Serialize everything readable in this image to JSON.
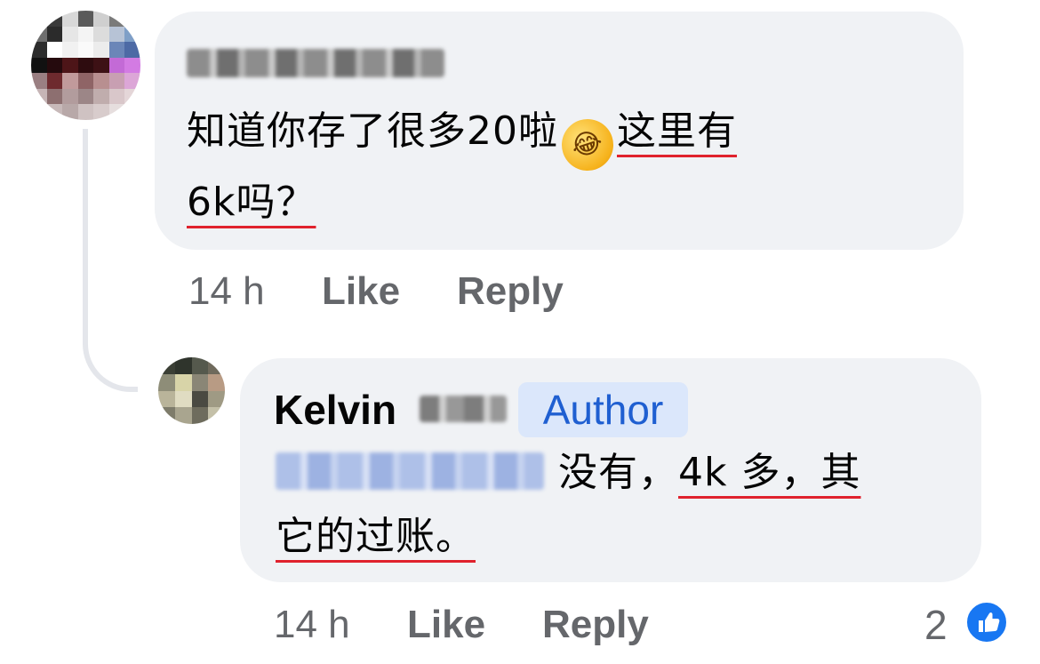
{
  "comment": {
    "author_name_blurred": "",
    "text_line1": "知道你存了很多20啦",
    "emoji_name": "rolling-on-floor-laughing",
    "text_highlight_1": "这里有",
    "text_line2_highlight": "6k吗？",
    "time": "14 h",
    "like_label": "Like",
    "reply_label": "Reply"
  },
  "reply": {
    "author_first_name": "Kelvin",
    "author_badge": "Author",
    "text_plain": "没有，",
    "text_highlight_1": "4k 多，其",
    "text_highlight_2": "它的过账",
    "text_end": "。",
    "time": "14 h",
    "like_label": "Like",
    "reply_label": "Reply",
    "reaction_count": "2"
  },
  "colors": {
    "bubble": "#f0f2f5",
    "underline": "#e0222d",
    "badge_bg": "#dbe7fb",
    "badge_text": "#1f5fd1",
    "like_blue": "#1877f2",
    "meta_gray": "#65676b"
  }
}
